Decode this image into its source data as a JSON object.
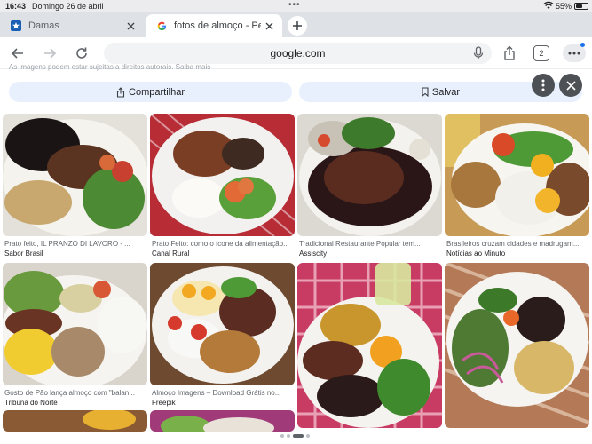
{
  "status": {
    "time": "16:43",
    "date": "Domingo 26 de abril",
    "battery": "55%",
    "battery_level": 0.55
  },
  "tabs": [
    {
      "title": "Damas",
      "favicon": "star-icon",
      "active": false
    },
    {
      "title": "fotos de almoço - Pesquisa Google",
      "favicon": "google-icon",
      "active": true
    }
  ],
  "toolbar": {
    "url": "google.com",
    "tab_count": "2"
  },
  "content": {
    "disclaimer": "As imagens podem estar sujeitas a direitos autorais. Saiba mais",
    "share_label": "Compartilhar",
    "save_label": "Salvar"
  },
  "results": [
    {
      "caption": "Prato feito, IL PRANZO DI LAVORO - ...",
      "source": "Sabor Brasil"
    },
    {
      "caption": "Prato Feito: como o ícone da alimentação...",
      "source": "Canal Rural"
    },
    {
      "caption": "Tradicional Restaurante Popular tem...",
      "source": "Assiscity"
    },
    {
      "caption": "Brasileiros cruzam cidades e madrugam...",
      "source": "Notícias ao Minuto"
    },
    {
      "caption": "Gosto de Pão lança almoço com \"balan...",
      "source": "Tribuna do Norte"
    },
    {
      "caption": "Almoço Imagens – Download Grátis no...",
      "source": "Freepik"
    },
    {
      "caption": "",
      "source": ""
    },
    {
      "caption": "",
      "source": ""
    }
  ],
  "colors": {
    "accent": "#1a73e8",
    "chip_bg": "#e8f0fe",
    "tabstrip": "#dee1e6"
  }
}
